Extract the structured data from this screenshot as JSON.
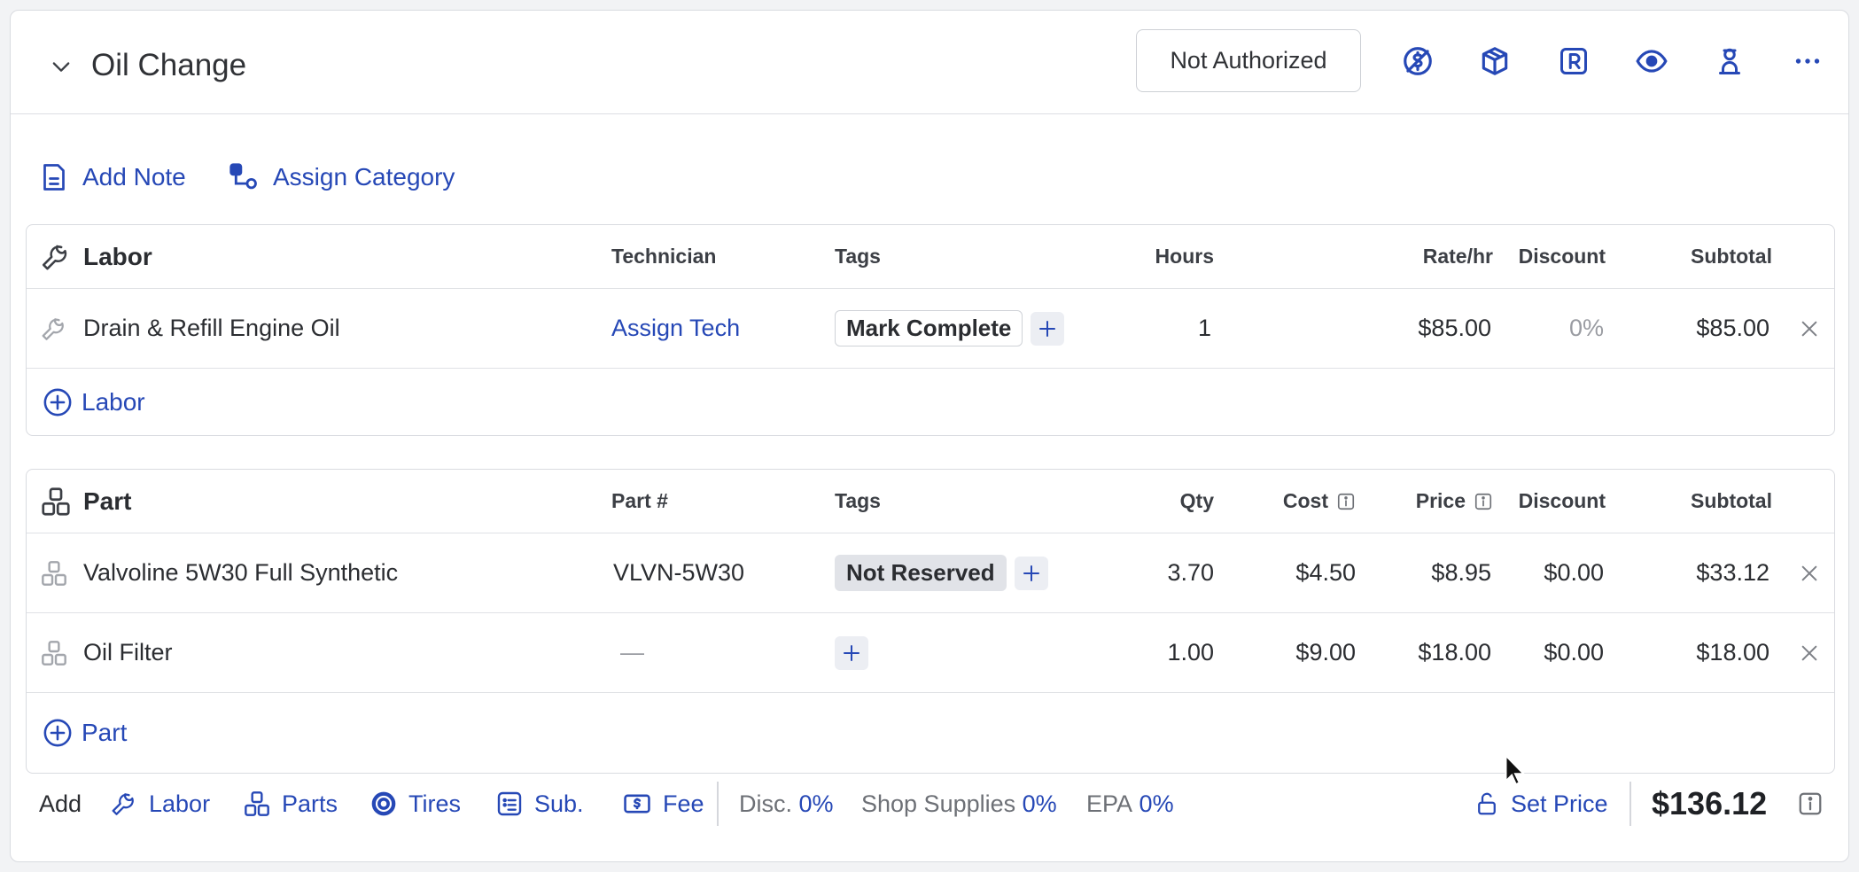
{
  "service": {
    "title": "Oil Change",
    "auth_status": "Not Authorized",
    "header_icons": [
      "no-charge-icon",
      "box-icon",
      "r-badge-icon",
      "eye-icon",
      "technician-icon",
      "more-icon"
    ]
  },
  "actions": {
    "add_note": "Add Note",
    "assign_category": "Assign Category"
  },
  "labor": {
    "headers": {
      "name": "Labor",
      "technician": "Technician",
      "tags": "Tags",
      "hours": "Hours",
      "rate": "Rate/hr",
      "discount": "Discount",
      "subtotal": "Subtotal"
    },
    "rows": [
      {
        "name": "Drain & Refill Engine Oil",
        "technician": "Assign Tech",
        "tag": "Mark Complete",
        "hours": "1",
        "rate": "$85.00",
        "discount": "0%",
        "subtotal": "$85.00"
      }
    ],
    "add_label": "Labor"
  },
  "parts": {
    "headers": {
      "name": "Part",
      "part_no": "Part #",
      "tags": "Tags",
      "qty": "Qty",
      "cost": "Cost",
      "price": "Price",
      "discount": "Discount",
      "subtotal": "Subtotal"
    },
    "rows": [
      {
        "name": "Valvoline 5W30 Full Synthetic",
        "part_no": "VLVN-5W30",
        "tag": "Not Reserved",
        "qty": "3.70",
        "cost": "$4.50",
        "price": "$8.95",
        "discount": "$0.00",
        "subtotal": "$33.12"
      },
      {
        "name": "Oil Filter",
        "part_no": "—",
        "tag": "",
        "qty": "1.00",
        "cost": "$9.00",
        "price": "$18.00",
        "discount": "$0.00",
        "subtotal": "$18.00"
      }
    ],
    "add_label": "Part"
  },
  "footer": {
    "add_label": "Add",
    "items": [
      "Labor",
      "Parts",
      "Tires",
      "Sub.",
      "Fee"
    ],
    "disc_label": "Disc.",
    "disc_value": "0%",
    "shop_supplies_label": "Shop Supplies",
    "shop_supplies_value": "0%",
    "epa_label": "EPA",
    "epa_value": "0%",
    "set_price": "Set Price",
    "total": "$136.12"
  },
  "colors": {
    "accent": "#2648b6",
    "border": "#d9dbe0",
    "tag_fill": "#e1e3e8",
    "text": "#25272c"
  }
}
